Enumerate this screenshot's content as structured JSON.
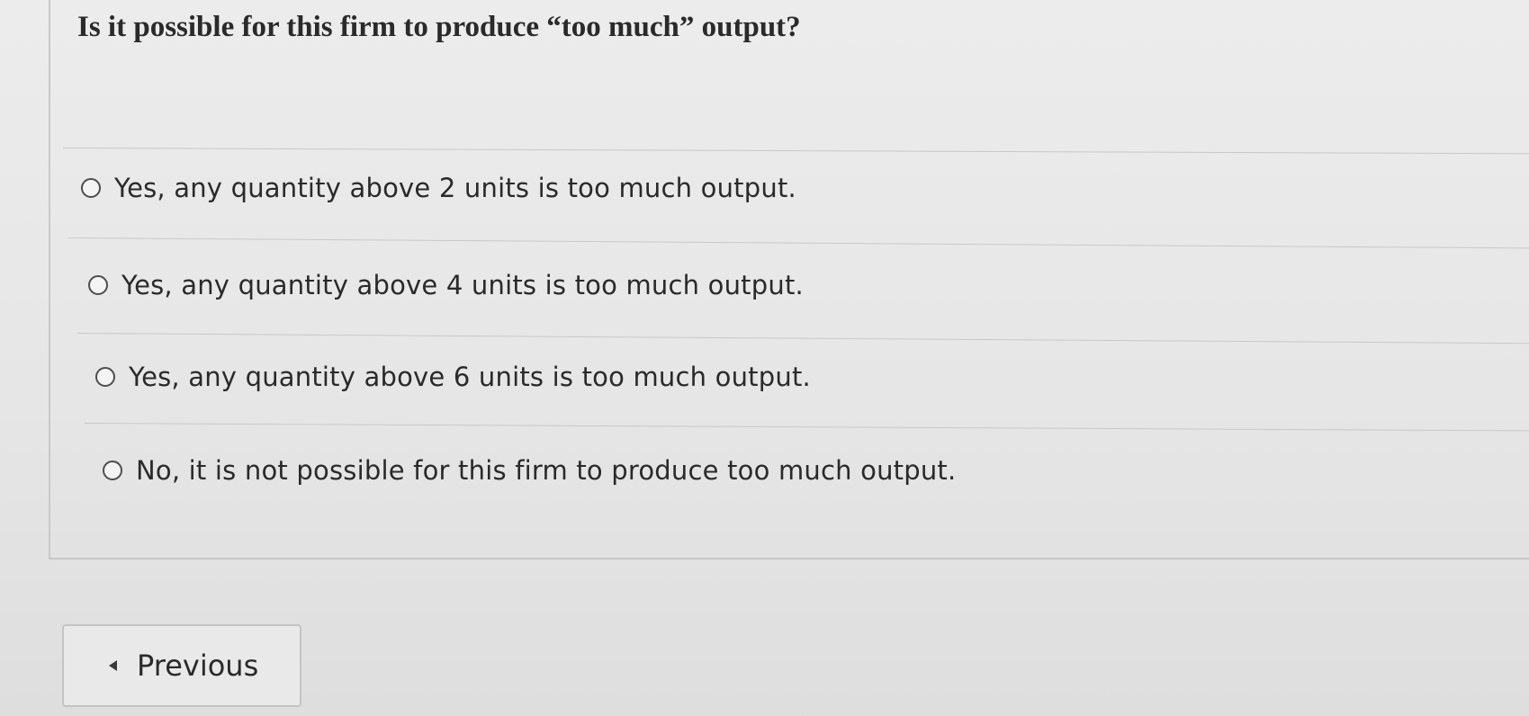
{
  "question": {
    "title": "Is it possible for this firm to produce “too much” output?"
  },
  "options": [
    {
      "label": "Yes, any quantity above 2 units is too much output."
    },
    {
      "label": "Yes, any quantity above 4 units is too much output."
    },
    {
      "label": "Yes, any quantity above 6 units is too much output."
    },
    {
      "label": "No, it is not possible for this firm to produce too much output."
    }
  ],
  "navigation": {
    "previous_label": "Previous",
    "previous_icon": "left-triangle-icon"
  }
}
